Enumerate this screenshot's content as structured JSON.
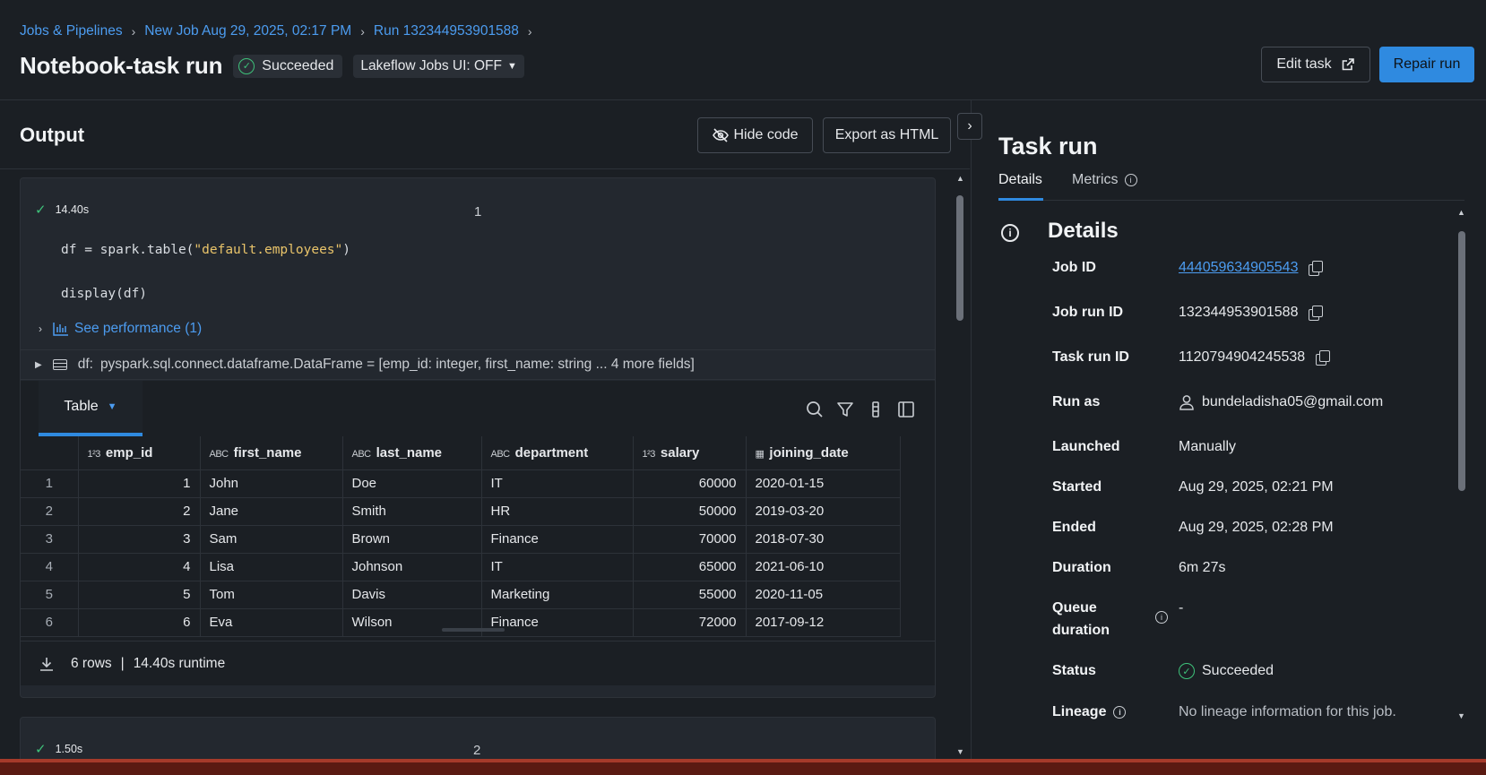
{
  "breadcrumbs": [
    "Jobs & Pipelines",
    "New Job Aug 29, 2025, 02:17 PM",
    "Run 132344953901588"
  ],
  "header": {
    "title": "Notebook-task run",
    "status": "Succeeded",
    "ui_toggle": "Lakeflow Jobs UI: OFF",
    "edit_task": "Edit task",
    "repair_run": "Repair run"
  },
  "output": {
    "title": "Output",
    "hide_code": "Hide code",
    "export_html": "Export as HTML"
  },
  "cells": [
    {
      "number": "1",
      "duration": "14.40s",
      "code": [
        "df = spark.table(",
        "\"default.employees\"",
        ")",
        "display(df)"
      ],
      "see_performance": "See performance (1)",
      "df_var": "df:",
      "df_schema": "pyspark.sql.connect.dataframe.DataFrame = [emp_id: integer, first_name: string ... 4 more fields]",
      "result": {
        "tab_label": "Table",
        "columns": [
          {
            "name": "emp_id",
            "type": "1²3"
          },
          {
            "name": "first_name",
            "type": "ABC"
          },
          {
            "name": "last_name",
            "type": "ABC"
          },
          {
            "name": "department",
            "type": "ABC"
          },
          {
            "name": "salary",
            "type": "1²3"
          },
          {
            "name": "joining_date",
            "type": "date"
          }
        ],
        "rows": [
          [
            "1",
            "1",
            "John",
            "Doe",
            "IT",
            "60000",
            "2020-01-15"
          ],
          [
            "2",
            "2",
            "Jane",
            "Smith",
            "HR",
            "50000",
            "2019-03-20"
          ],
          [
            "3",
            "3",
            "Sam",
            "Brown",
            "Finance",
            "70000",
            "2018-07-30"
          ],
          [
            "4",
            "4",
            "Lisa",
            "Johnson",
            "IT",
            "65000",
            "2021-06-10"
          ],
          [
            "5",
            "5",
            "Tom",
            "Davis",
            "Marketing",
            "55000",
            "2020-11-05"
          ],
          [
            "6",
            "6",
            "Eva",
            "Wilson",
            "Finance",
            "72000",
            "2017-09-12"
          ]
        ],
        "row_count": "6 rows",
        "runtime": "14.40s runtime"
      }
    },
    {
      "number": "2",
      "duration": "1.50s"
    }
  ],
  "task_run": {
    "title": "Task run",
    "tabs": [
      "Details",
      "Metrics"
    ],
    "details_heading": "Details",
    "fields": {
      "job_id_label": "Job ID",
      "job_id": "444059634905543",
      "job_run_id_label": "Job run ID",
      "job_run_id": "132344953901588",
      "task_run_id_label": "Task run ID",
      "task_run_id": "1120794904245538",
      "run_as_label": "Run as",
      "run_as": "bundeladisha05@gmail.com",
      "launched_label": "Launched",
      "launched": "Manually",
      "started_label": "Started",
      "started": "Aug 29, 2025, 02:21 PM",
      "ended_label": "Ended",
      "ended": "Aug 29, 2025, 02:28 PM",
      "duration_label": "Duration",
      "duration": "6m 27s",
      "queue_label_1": "Queue",
      "queue_label_2": "duration",
      "queue_duration": "-",
      "status_label": "Status",
      "status": "Succeeded",
      "lineage_label": "Lineage",
      "lineage": "No lineage information for this job."
    }
  },
  "colors": {
    "accent": "#2f8ae0",
    "link": "#4c9cf0",
    "success": "#3ec27a",
    "background": "#1b1f24"
  }
}
